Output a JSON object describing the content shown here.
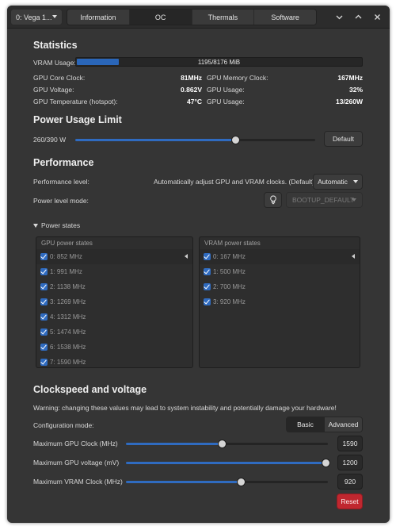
{
  "header": {
    "gpu_select": "0: Vega 1...",
    "tabs": [
      "Information",
      "OC",
      "Thermals",
      "Software"
    ],
    "active_tab": "OC"
  },
  "statistics": {
    "title": "Statistics",
    "vram_label": "VRAM Usage:",
    "vram_value": "1195/8176 MiB",
    "vram_fraction": 0.146,
    "rows": [
      {
        "left_label": "GPU Core Clock:",
        "left_value": "81MHz",
        "right_label": "GPU Memory Clock:",
        "right_value": "167MHz"
      },
      {
        "left_label": "GPU Voltage:",
        "left_value": "0.862V",
        "right_label": "GPU Usage:",
        "right_value": "32%"
      },
      {
        "left_label": "GPU Temperature (hotspot):",
        "left_value": "47°C",
        "right_label": "GPU Usage:",
        "right_value": "13/260W"
      }
    ]
  },
  "power_limit": {
    "title": "Power Usage Limit",
    "value_text": "260/390 W",
    "fraction": 0.667,
    "default_label": "Default"
  },
  "performance": {
    "title": "Performance",
    "level_label": "Performance level:",
    "level_description": "Automatically adjust GPU and VRAM clocks. (Default)",
    "level_value": "Automatic",
    "mode_label": "Power level mode:",
    "mode_value": "BOOTUP_DEFAULT",
    "power_states_label": "Power states",
    "gpu_states_header": "GPU power states",
    "vram_states_header": "VRAM power states",
    "gpu_states": [
      "0: 852 MHz",
      "1: 991 MHz",
      "2: 1138 MHz",
      "3: 1269 MHz",
      "4: 1312 MHz",
      "5: 1474 MHz",
      "6: 1538 MHz",
      "7: 1590 MHz"
    ],
    "vram_states": [
      "0: 167 MHz",
      "1: 500 MHz",
      "2: 700 MHz",
      "3: 920 MHz"
    ]
  },
  "clockspeed": {
    "title": "Clockspeed and voltage",
    "warning": "Warning: changing these values may lead to system instability and potentially damage your hardware!",
    "config_label": "Configuration mode:",
    "basic_label": "Basic",
    "advanced_label": "Advanced",
    "active_mode": "Basic",
    "sliders": [
      {
        "label": "Maximum GPU Clock (MHz)",
        "value": "1590",
        "fraction": 0.476
      },
      {
        "label": "Maximum GPU voltage (mV)",
        "value": "1200",
        "fraction": 0.99
      },
      {
        "label": "Maximum VRAM Clock (MHz)",
        "value": "920",
        "fraction": 0.567
      }
    ],
    "reset_label": "Reset"
  },
  "colors": {
    "accent": "#2f6bc0",
    "destructive": "#c0272f",
    "background": "#353535"
  }
}
